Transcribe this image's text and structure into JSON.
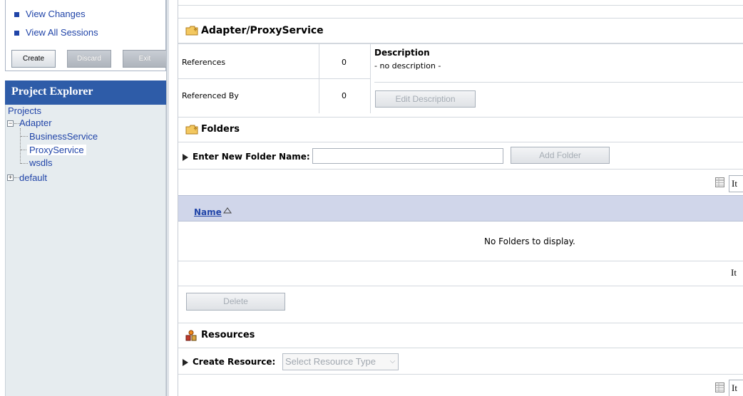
{
  "session": {
    "links": [
      "View Changes",
      "View All Sessions"
    ],
    "buttons": {
      "create": "Create",
      "discard": "Discard",
      "exit": "Exit"
    }
  },
  "explorer": {
    "title": "Project Explorer",
    "root": "Projects",
    "tree": {
      "adapter": "Adapter",
      "business": "BusinessService",
      "proxy": "ProxyService",
      "wsdls": "wsdls",
      "default": "default"
    }
  },
  "main": {
    "title": "Adapter/ProxyService",
    "references_label": "References",
    "references_count": "0",
    "referenced_by_label": "Referenced By",
    "referenced_by_count": "0",
    "description_heading": "Description",
    "description_text": "- no description -",
    "edit_description_btn": "Edit Description",
    "folders": {
      "title": "Folders",
      "new_folder_label": "Enter New Folder Name:",
      "new_folder_value": "",
      "add_folder_btn": "Add Folder",
      "column_name": "Name",
      "empty_text": "No Folders to display.",
      "items_label": "It",
      "delete_btn": "Delete"
    },
    "resources": {
      "title": "Resources",
      "create_label": "Create Resource:",
      "select_value": "Select Resource Type",
      "items_label": "It"
    }
  },
  "colors": {
    "header_blue": "#2e5ca8",
    "link_blue": "#2044a8",
    "table_header": "#d0d6ea"
  },
  "icons": [
    "folder-icon",
    "resources-icon",
    "table-icon",
    "sort-ascending-icon",
    "expand-triangle-icon"
  ]
}
